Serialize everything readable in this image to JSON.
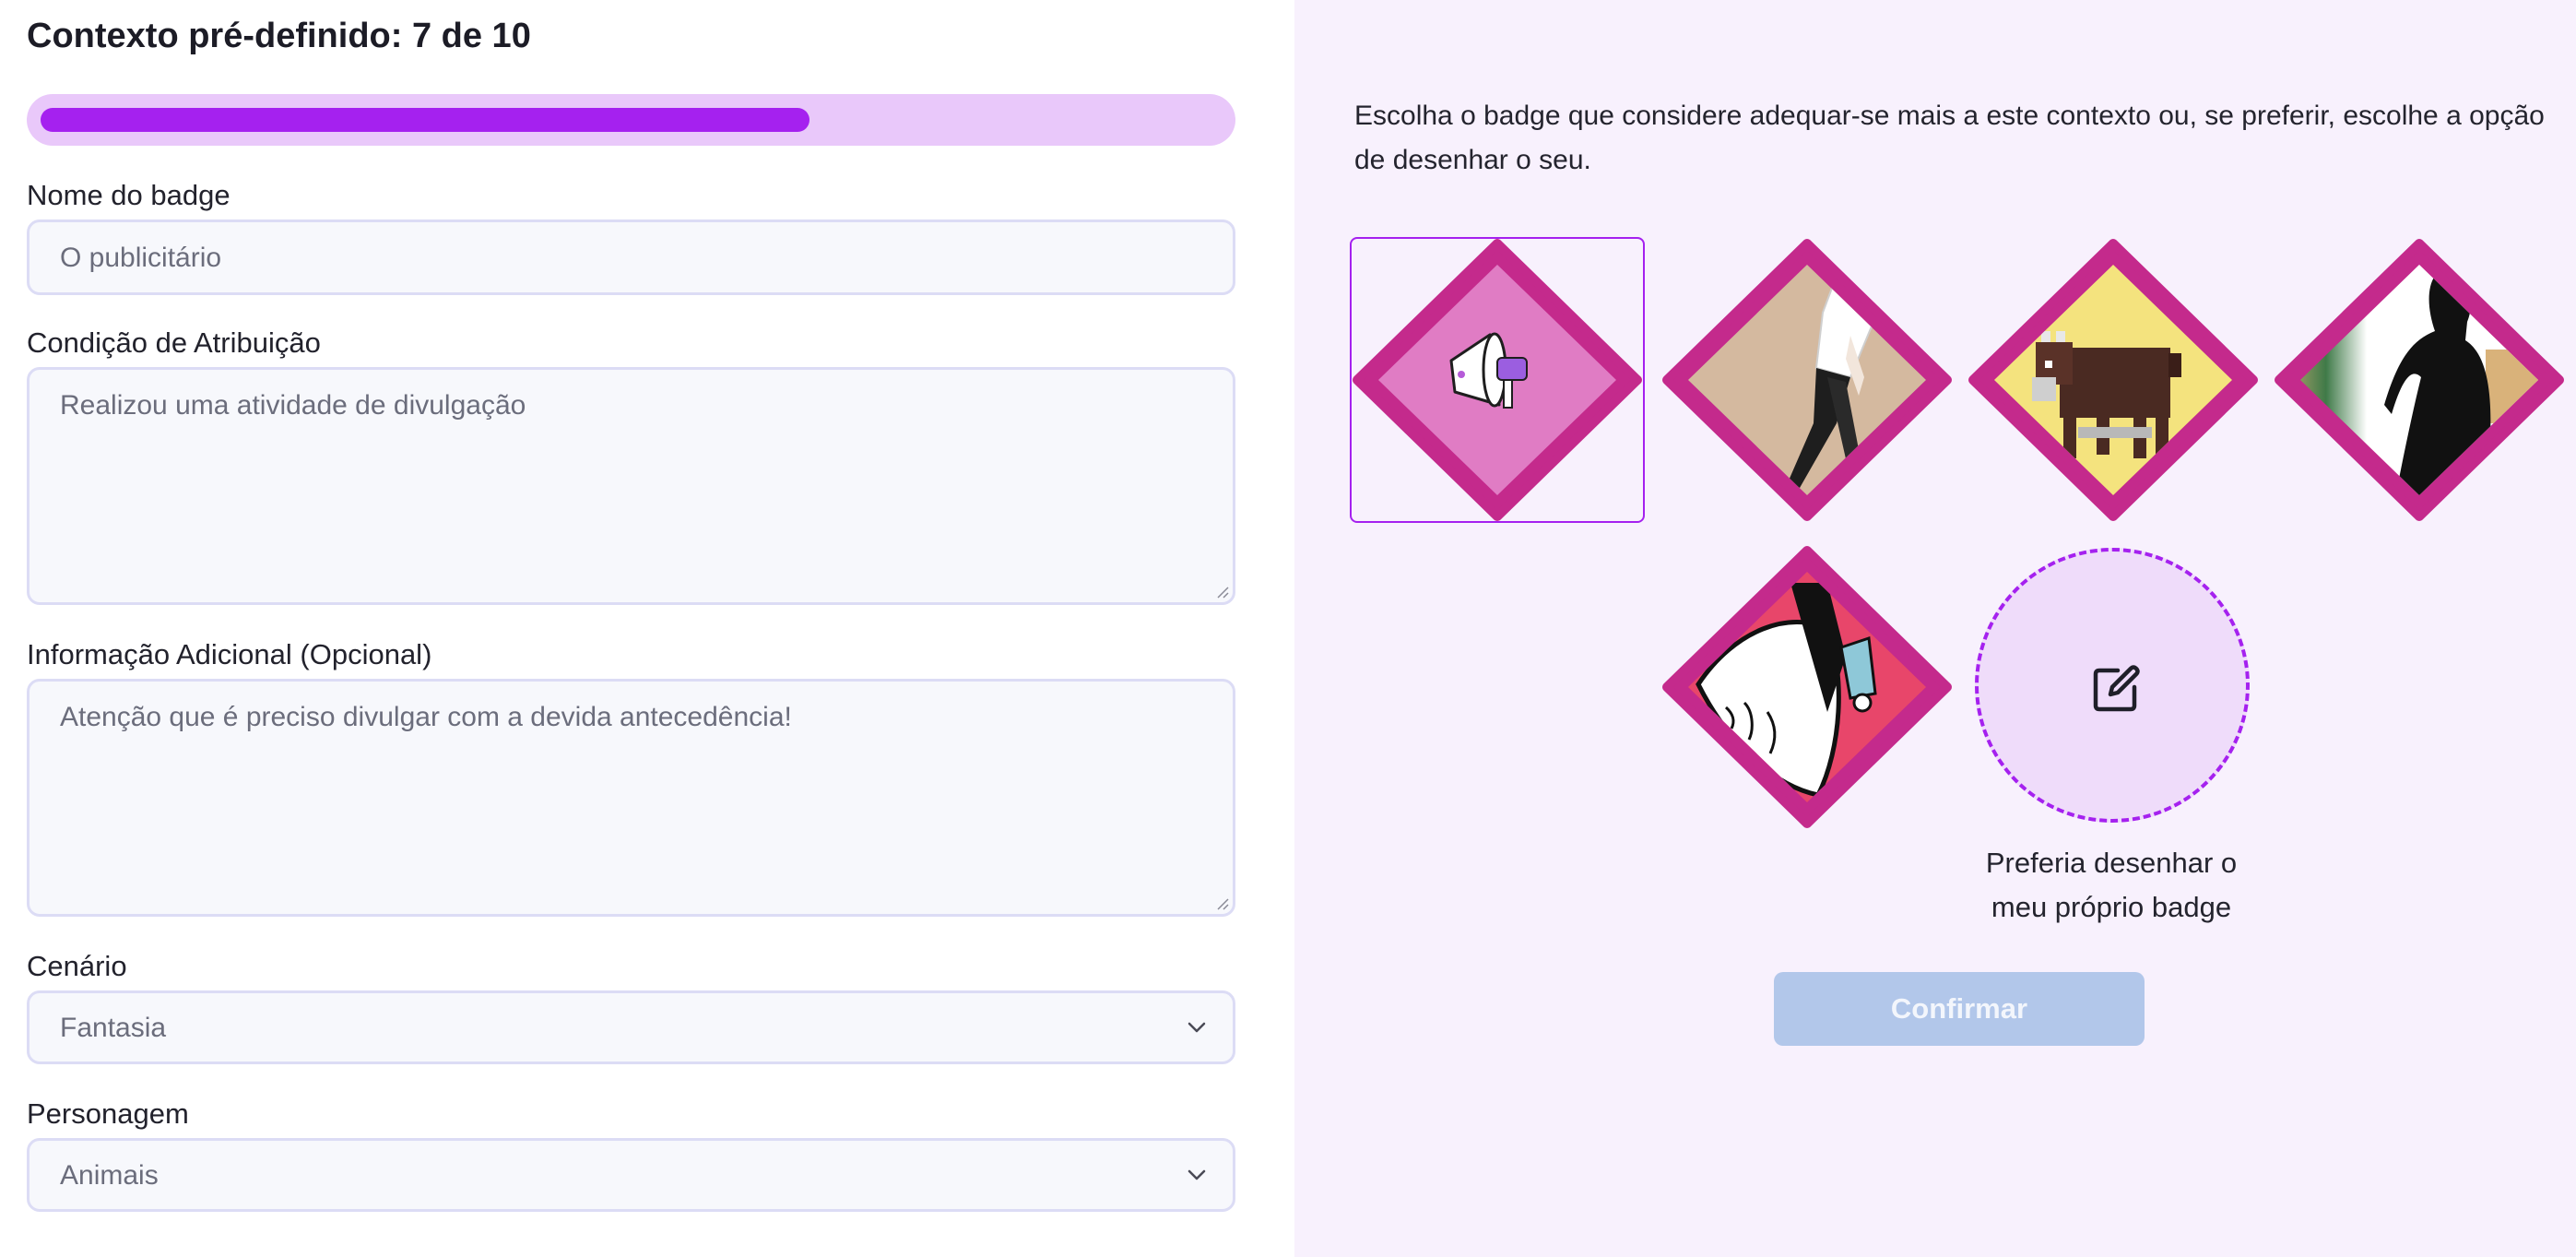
{
  "header": {
    "title": "Contexto pré-definido: 7 de 10"
  },
  "progress": {
    "current": 7,
    "total": 10,
    "fraction": 0.7,
    "track_color": "#e9c8fa",
    "fill_color": "#a521ef"
  },
  "form": {
    "badge_name": {
      "label": "Nome do badge",
      "value": "O publicitário"
    },
    "condition": {
      "label": "Condição de Atribuição",
      "value": "Realizou uma atividade de divulgação"
    },
    "extra_info": {
      "label": "Informação Adicional (Opcional)",
      "value": "Atenção que é preciso divulgar com a devida antecedência!"
    },
    "scenario": {
      "label": "Cenário",
      "selected": "Fantasia"
    },
    "character": {
      "label": "Personagem",
      "selected": "Animais"
    }
  },
  "badges": {
    "intro": "Escolha o badge que considere adequar-se mais a este contexto ou, se preferir, escolhe a opção de desenhar o seu.",
    "frame_color": "#c42a8c",
    "selected_index": 0,
    "options": [
      {
        "icon": "megaphone-icon"
      },
      {
        "icon": "walking-figure-icon"
      },
      {
        "icon": "pixel-bison-icon"
      },
      {
        "icon": "silhouette-figure-icon"
      },
      {
        "icon": "cartoon-character-icon"
      }
    ],
    "draw_own": {
      "icon": "edit-icon",
      "caption_line1": "Preferia desenhar o",
      "caption_line2": "meu próprio badge"
    }
  },
  "actions": {
    "confirm_label": "Confirmar",
    "confirm_enabled": false
  }
}
